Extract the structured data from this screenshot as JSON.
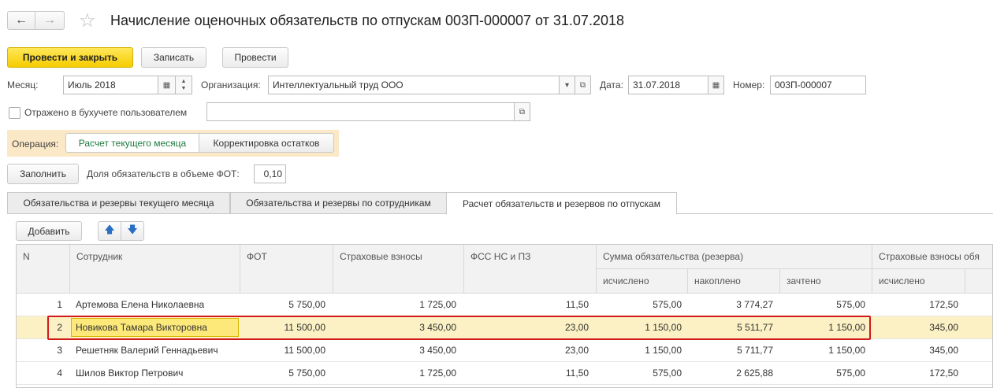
{
  "header": {
    "back": "←",
    "forward": "→",
    "star": "☆",
    "title": "Начисление оценочных обязательств по отпускам 003П-000007 от 31.07.2018"
  },
  "toolbar": {
    "post_close": "Провести и закрыть",
    "write": "Записать",
    "post": "Провести"
  },
  "form": {
    "month_label": "Месяц:",
    "month_value": "Июль 2018",
    "org_label": "Организация:",
    "org_value": "Интеллектуальный труд ООО",
    "date_label": "Дата:",
    "date_value": "31.07.2018",
    "number_label": "Номер:",
    "number_value": "003П-000007",
    "reflected_label": "Отражено в бухучете пользователем",
    "operation_label": "Операция:",
    "operation_opt1": "Расчет текущего месяца",
    "operation_opt2": "Корректировка остатков",
    "fill_button": "Заполнить",
    "share_label": "Доля обязательств в объеме ФОТ:",
    "share_value": "0,10"
  },
  "tabs": [
    {
      "label": "Обязательства и резервы текущего месяца"
    },
    {
      "label": "Обязательства и резервы по сотрудникам"
    },
    {
      "label": "Расчет обязательств и резервов по отпускам"
    }
  ],
  "table_toolbar": {
    "add": "Добавить",
    "up": "🡅",
    "down": "🡇"
  },
  "table": {
    "headers": {
      "n": "N",
      "employee": "Сотрудник",
      "fot": "ФОТ",
      "insurance": "Страховые взносы",
      "fss": "ФСС НС и ПЗ",
      "sum_group": "Сумма обязательства (резерва)",
      "calculated": "исчислено",
      "accumulated": "накоплено",
      "credited": "зачтено",
      "ins_group": "Страховые взносы обя",
      "ins_calculated": "исчислено"
    },
    "rows": [
      {
        "n": "1",
        "employee": "Артемова Елена Николаевна",
        "fot": "5 750,00",
        "insurance": "1 725,00",
        "fss": "11,50",
        "calculated": "575,00",
        "accumulated": "3 774,27",
        "credited": "575,00",
        "ins_calculated": "172,50"
      },
      {
        "n": "2",
        "employee": "Новикова Тамара Викторовна",
        "fot": "11 500,00",
        "insurance": "3 450,00",
        "fss": "23,00",
        "calculated": "1 150,00",
        "accumulated": "5 511,77",
        "credited": "1 150,00",
        "ins_calculated": "345,00"
      },
      {
        "n": "3",
        "employee": "Решетняк Валерий Геннадьевич",
        "fot": "11 500,00",
        "insurance": "3 450,00",
        "fss": "23,00",
        "calculated": "1 150,00",
        "accumulated": "5 711,77",
        "credited": "1 150,00",
        "ins_calculated": "345,00"
      },
      {
        "n": "4",
        "employee": "Шилов Виктор Петрович",
        "fot": "5 750,00",
        "insurance": "1 725,00",
        "fss": "11,50",
        "calculated": "575,00",
        "accumulated": "2 625,88",
        "credited": "575,00",
        "ins_calculated": "172,50"
      }
    ]
  }
}
